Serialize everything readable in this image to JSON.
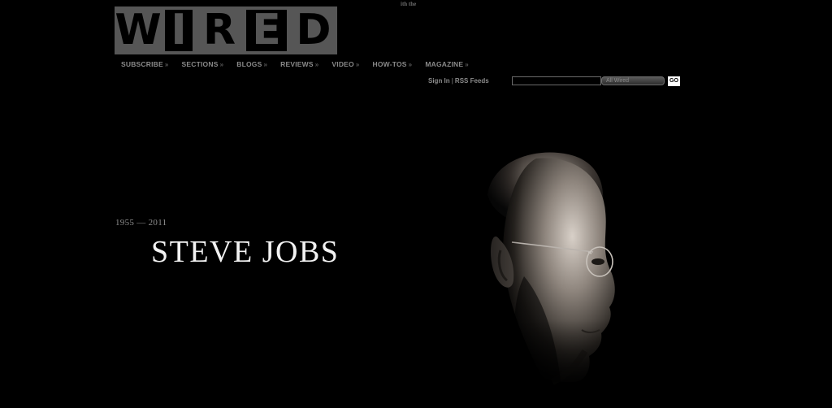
{
  "header": {
    "logo_letters": [
      "W",
      "I",
      "R",
      "E",
      "D"
    ],
    "tagline": "ith the"
  },
  "nav": {
    "items": [
      {
        "label": "SUBSCRIBE",
        "arrow": "»"
      },
      {
        "label": "SECTIONS",
        "arrow": "»"
      },
      {
        "label": "BLOGS",
        "arrow": "»"
      },
      {
        "label": "REVIEWS",
        "arrow": "»"
      },
      {
        "label": "VIDEO",
        "arrow": "»"
      },
      {
        "label": "HOW-TOS",
        "arrow": "»"
      },
      {
        "label": "MAGAZINE",
        "arrow": "»"
      }
    ]
  },
  "utility": {
    "sign_in": "Sign In",
    "separator": "|",
    "rss": "RSS Feeds"
  },
  "search": {
    "value": "",
    "scope_label": "All Wired",
    "go_label": "GO"
  },
  "tribute": {
    "dates": "1955 — 2011",
    "name": "STEVE JOBS"
  },
  "colors": {
    "background": "#000000",
    "logo_gray": "#565656",
    "nav_text": "#8a8a8a",
    "headline": "#f2f2f2"
  },
  "icons": {
    "nav_arrow": "double-chevron-right-icon"
  }
}
